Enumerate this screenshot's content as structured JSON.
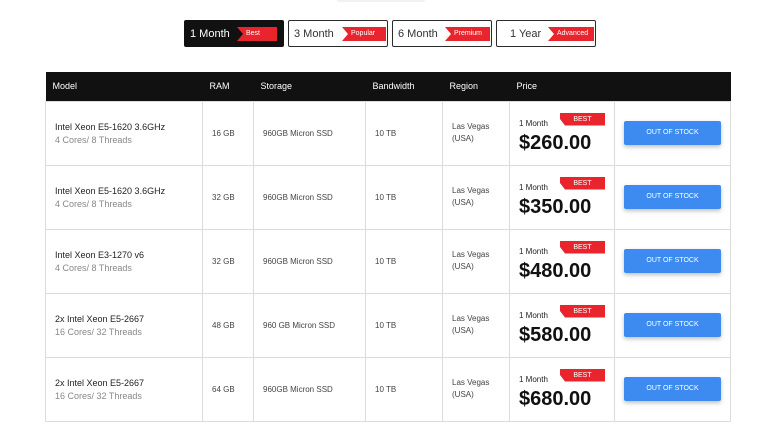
{
  "tabs": [
    {
      "label": "1 Month",
      "badge": "Best",
      "active": true
    },
    {
      "label": "3 Month",
      "badge": "Popular",
      "active": false
    },
    {
      "label": "6 Month",
      "badge": "Premium",
      "active": false
    },
    {
      "label": "1 Year",
      "badge": "Advanced",
      "active": false
    }
  ],
  "columns": [
    "Model",
    "RAM",
    "Storage",
    "Bandwidth",
    "Region",
    "Price",
    ""
  ],
  "rows": [
    {
      "model": "Intel Xeon E5-1620 3.6GHz",
      "cores": "4 Cores/ 8 Threads",
      "ram": "16 GB",
      "storage": "960GB Micron SSD",
      "bandwidth": "10 TB",
      "region": "Las Vegas (USA)",
      "period": "1 Month",
      "badge": "BEST",
      "price": "$260.00",
      "action": "OUT OF STOCK"
    },
    {
      "model": "Intel Xeon E5-1620 3.6GHz",
      "cores": "4 Cores/ 8 Threads",
      "ram": "32 GB",
      "storage": "960GB Micron SSD",
      "bandwidth": "10 TB",
      "region": "Las Vegas (USA)",
      "period": "1 Month",
      "badge": "BEST",
      "price": "$350.00",
      "action": "OUT OF STOCK"
    },
    {
      "model": "Intel Xeon E3-1270 v6",
      "cores": "4 Cores/ 8 Threads",
      "ram": "32 GB",
      "storage": "960GB Micron SSD",
      "bandwidth": "10 TB",
      "region": "Las Vegas (USA)",
      "period": "1 Month",
      "badge": "BEST",
      "price": "$480.00",
      "action": "OUT OF STOCK"
    },
    {
      "model": "2x Intel Xeon E5-2667",
      "cores": "16 Cores/ 32 Threads",
      "ram": "48 GB",
      "storage": "960 GB Micron SSD",
      "bandwidth": "10 TB",
      "region": "Las Vegas (USA)",
      "period": "1 Month",
      "badge": "BEST",
      "price": "$580.00",
      "action": "OUT OF STOCK"
    },
    {
      "model": "2x Intel Xeon E5-2667",
      "cores": "16 Cores/ 32 Threads",
      "ram": "64 GB",
      "storage": "960GB Micron SSD",
      "bandwidth": "10 TB",
      "region": "Las Vegas (USA)",
      "period": "1 Month",
      "badge": "BEST",
      "price": "$680.00",
      "action": "OUT OF STOCK"
    }
  ]
}
